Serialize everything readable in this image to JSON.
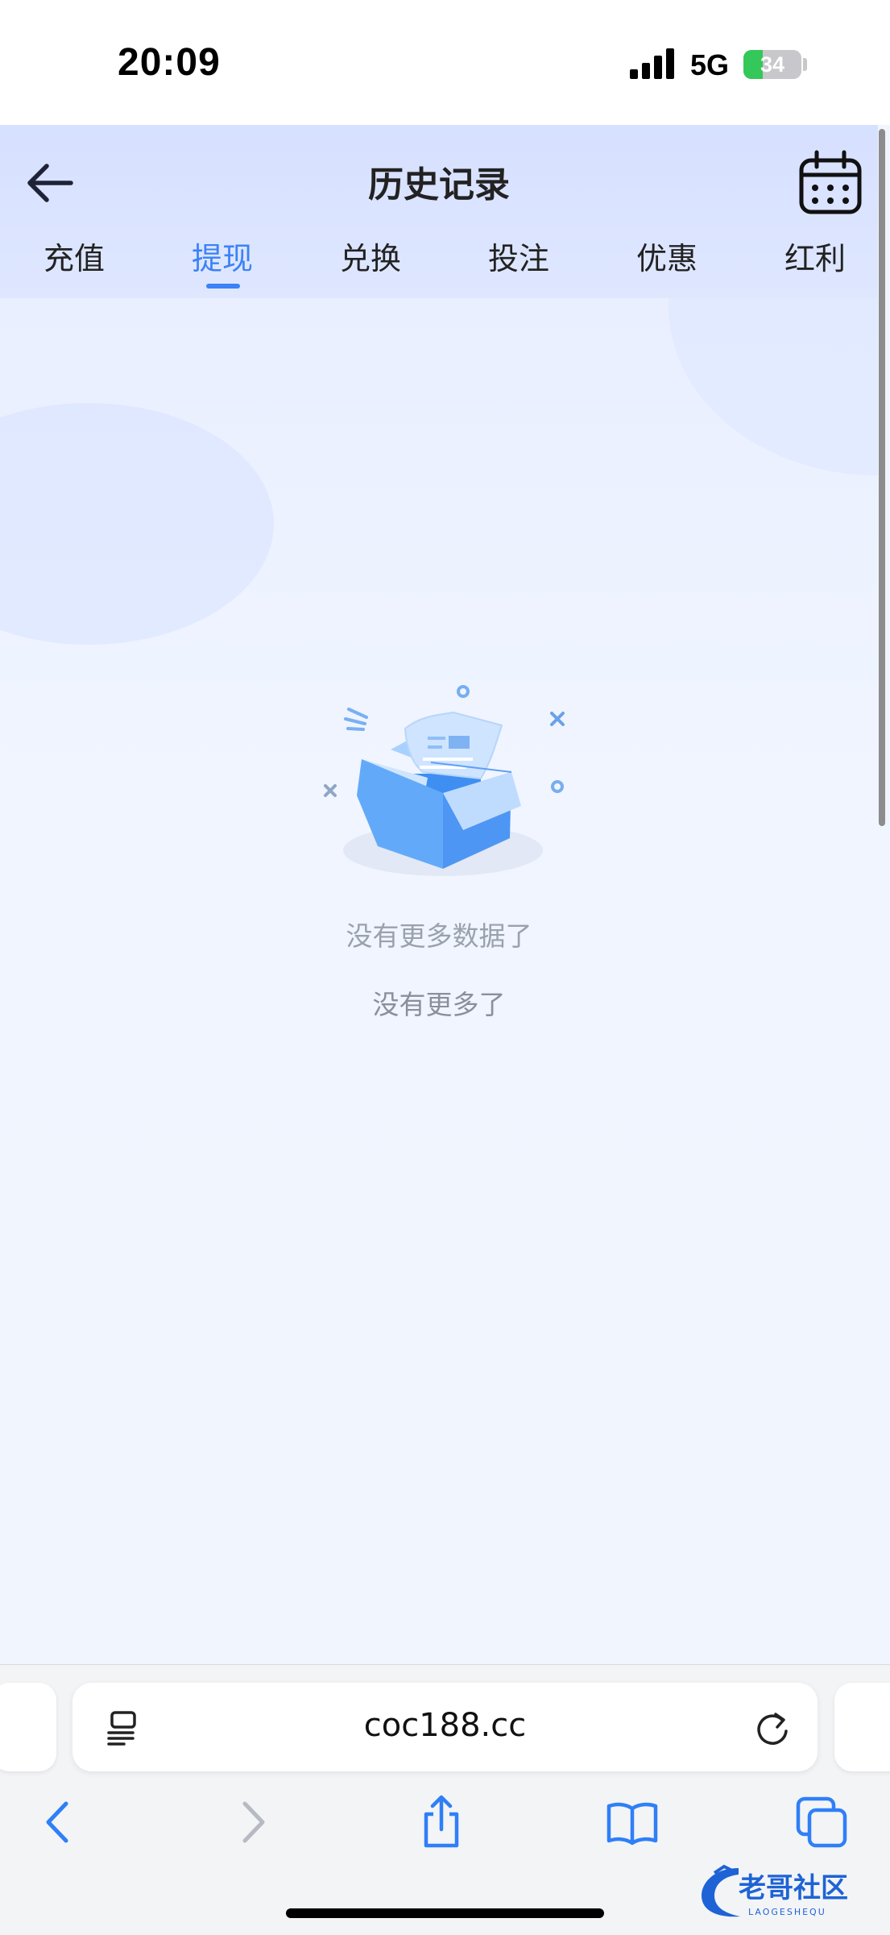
{
  "status_bar": {
    "time": "20:09",
    "network": "5G",
    "battery": "34"
  },
  "header": {
    "title": "历史记录"
  },
  "tabs": [
    {
      "label": "充值",
      "active": false
    },
    {
      "label": "提现",
      "active": true
    },
    {
      "label": "兑换",
      "active": false
    },
    {
      "label": "投注",
      "active": false
    },
    {
      "label": "优惠",
      "active": false
    },
    {
      "label": "红利",
      "active": false
    }
  ],
  "content": {
    "empty_message": "没有更多数据了",
    "footer_message": "没有更多了"
  },
  "browser": {
    "url": "coc188.cc"
  },
  "watermark": {
    "text": "老哥社区",
    "subtext": "LAOGESHEQU"
  },
  "colors": {
    "accent": "#3b82f6",
    "header_bg": "#d6e0ff",
    "page_bg": "#f0f5ff",
    "battery_green": "#34c759"
  }
}
